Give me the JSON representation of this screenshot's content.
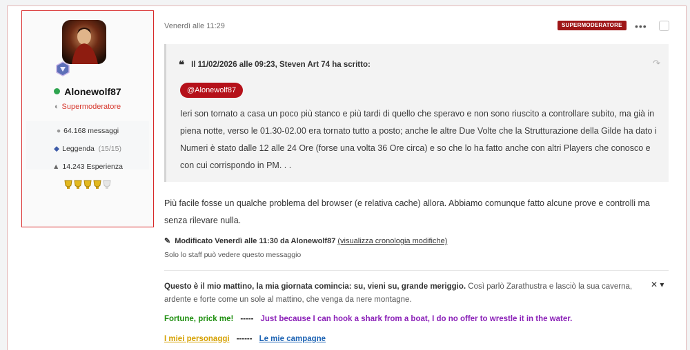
{
  "user": {
    "name": "Alonewolf87",
    "role": "Supermoderatore",
    "messages": "64.168 messaggi",
    "rank": "Leggenda",
    "rank_progress": "(15/15)",
    "experience": "14.243 Esperienza",
    "trophies_filled": 4,
    "trophies_total": 5
  },
  "post": {
    "date": "Venerdì alle 11:29",
    "badge": "SUPERMODERATORE",
    "more": "•••",
    "quote_header": "Il 11/02/2026 alle 09:23, Steven Art 74 ha scritto:",
    "mention": "@Alonewolf87",
    "quote_text": "Ieri son tornato a casa un poco più stanco e più tardi di quello che speravo e non sono riuscito a controllare subito, ma già in piena notte, verso le 01.30-02.00 era tornato tutto a posto; anche le altre Due Volte che la Strutturazione della Gilde ha dato i Numeri è stato dalle 12 alle 24 Ore (forse una volta 36 Ore circa) e so che lo ha fatto anche con altri Players che conosco e con cui corrispondo in PM. . .",
    "body": "Più facile fosse un qualche problema del browser (e relativa cache) allora. Abbiamo comunque fatto alcune prove e controlli ma senza rilevare nulla.",
    "edited": "Modificato Venerdì alle 11:30 da Alonewolf87",
    "edit_history": "(visualizza cronologia modifiche)",
    "staff_note": "Solo lo staff può vedere questo messaggio"
  },
  "signature": {
    "bold": "Questo è il mio mattino, la mia giornata comincia: su, vieni su, grande meriggio.",
    "rest": "Così parlò Zarathustra e lasciò la sua caverna, ardente e forte come un sole al mattino, che venga da nere montagne.",
    "controls": "✕ ▾",
    "fortune": "Fortune, prick me!",
    "dashes": "-----",
    "shark": "Just because I can hook a shark from a boat, I do no offer to wrestle it in the water.",
    "characters": "I miei personaggi",
    "dashes2": "------",
    "campaigns": "Le mie campagne"
  },
  "colors": {
    "accent_red": "#d72828",
    "badge_bg": "#9e1617",
    "mention_bg": "#b5111a",
    "green": "#1f8f10",
    "purple": "#8b21b8",
    "gold": "#d5a000",
    "blue": "#1e64b4"
  }
}
